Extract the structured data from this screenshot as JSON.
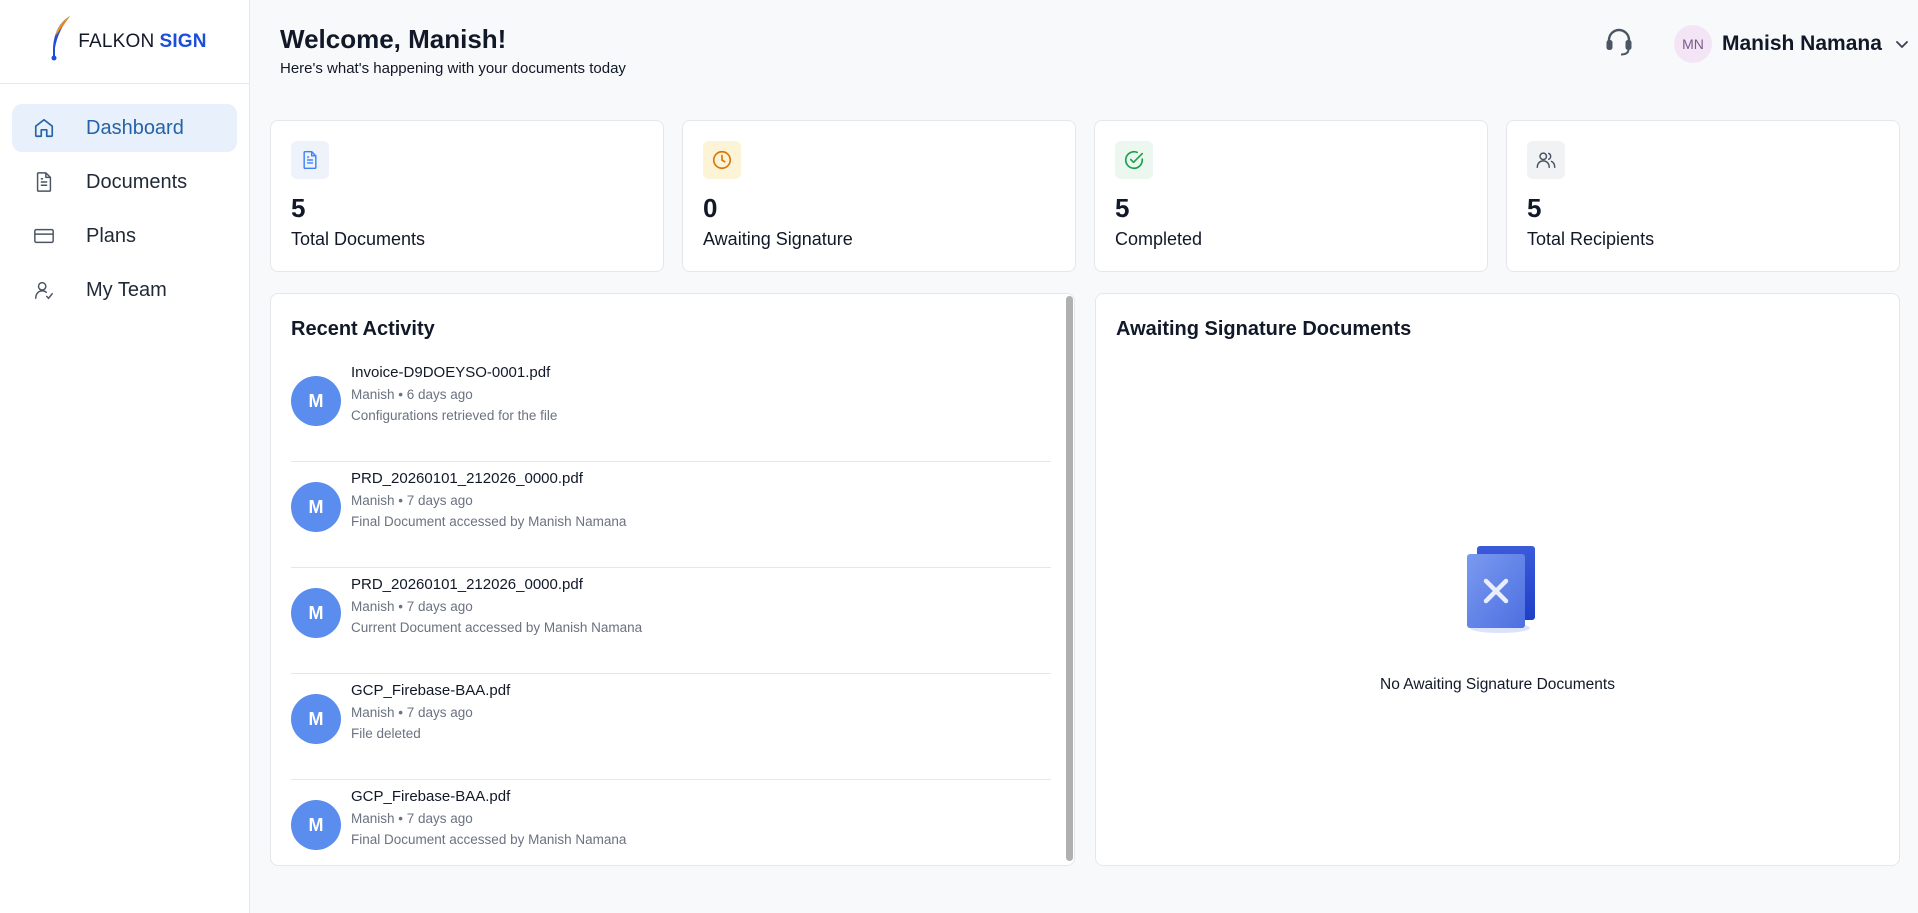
{
  "brand": {
    "name_part1": "FALKON",
    "name_part2": "SIGN"
  },
  "sidebar": {
    "items": [
      {
        "label": "Dashboard",
        "icon": "home-icon",
        "active": true
      },
      {
        "label": "Documents",
        "icon": "document-icon",
        "active": false
      },
      {
        "label": "Plans",
        "icon": "credit-card-icon",
        "active": false
      },
      {
        "label": "My Team",
        "icon": "team-icon",
        "active": false
      }
    ]
  },
  "header": {
    "title": "Welcome, Manish!",
    "subtitle": "Here's what's happening with your documents today",
    "user": {
      "initials": "MN",
      "name": "Manish Namana"
    }
  },
  "stats": [
    {
      "value": "5",
      "label": "Total Documents",
      "icon": "document-icon",
      "color": "#3b82f6",
      "bg": "#eef2fb"
    },
    {
      "value": "0",
      "label": "Awaiting Signature",
      "icon": "clock-icon",
      "color": "#d97706",
      "bg": "#fdf3d6"
    },
    {
      "value": "5",
      "label": "Completed",
      "icon": "check-circle-icon",
      "color": "#16a34a",
      "bg": "#ecf7ef"
    },
    {
      "value": "5",
      "label": "Total Recipients",
      "icon": "users-icon",
      "color": "#4b5563",
      "bg": "#f1f2f4"
    }
  ],
  "recent": {
    "title": "Recent Activity",
    "items": [
      {
        "initial": "M",
        "file": "Invoice-D9DOEYSO-0001.pdf",
        "meta": "Manish • 6 days ago",
        "desc": "Configurations retrieved for the file"
      },
      {
        "initial": "M",
        "file": "PRD_20260101_212026_0000.pdf",
        "meta": "Manish • 7 days ago",
        "desc": "Final Document accessed by Manish Namana"
      },
      {
        "initial": "M",
        "file": "PRD_20260101_212026_0000.pdf",
        "meta": "Manish • 7 days ago",
        "desc": "Current Document accessed by Manish Namana"
      },
      {
        "initial": "M",
        "file": "GCP_Firebase-BAA.pdf",
        "meta": "Manish • 7 days ago",
        "desc": "File deleted"
      },
      {
        "initial": "M",
        "file": "GCP_Firebase-BAA.pdf",
        "meta": "Manish • 7 days ago",
        "desc": "Final Document accessed by Manish Namana"
      }
    ]
  },
  "awaiting": {
    "title": "Awaiting Signature Documents",
    "empty_text": "No Awaiting Signature Documents"
  },
  "colors": {
    "accent": "#2563a8",
    "avatar": "#5b8def",
    "brand_blue": "#1d4ed8"
  }
}
